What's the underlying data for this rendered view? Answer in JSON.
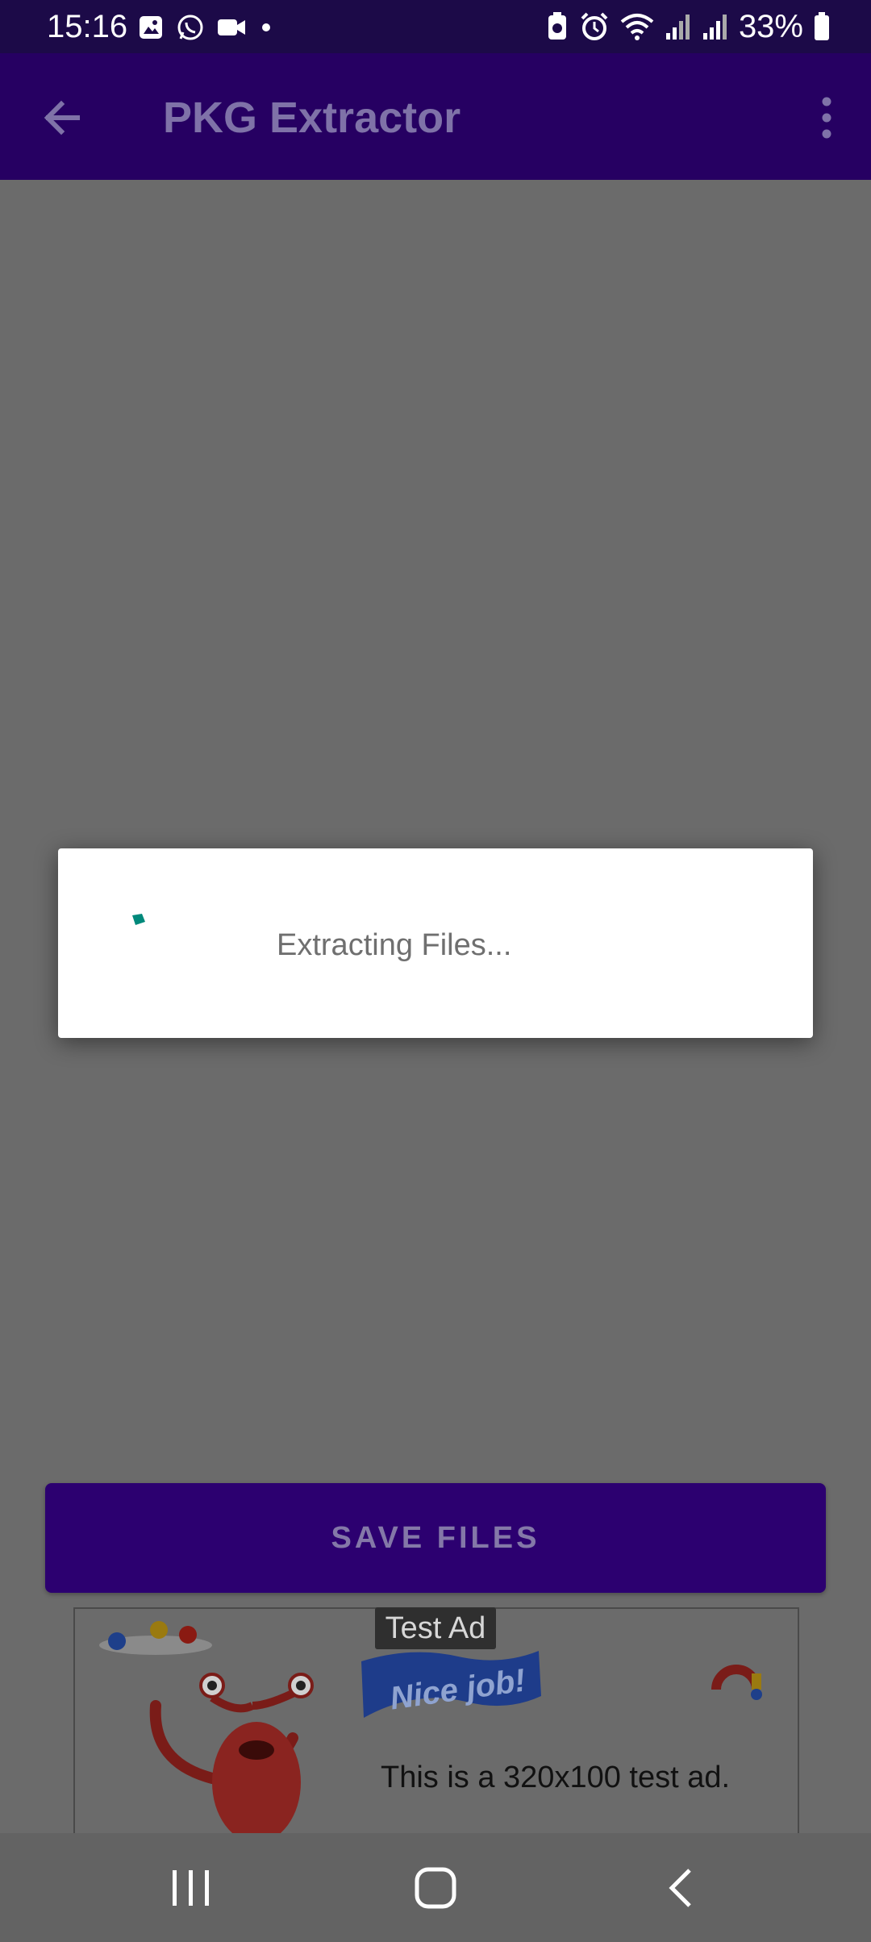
{
  "status_bar": {
    "time": "15:16",
    "battery_percent": "33%",
    "icons": [
      "gallery-icon",
      "whatsapp-icon",
      "video-icon",
      "dot-icon",
      "battery-saver-icon",
      "alarm-icon",
      "wifi-icon",
      "signal-icon",
      "signal-icon",
      "battery-icon"
    ]
  },
  "app_bar": {
    "title": "PKG Extractor",
    "back_icon": "arrow-left-icon",
    "menu_icon": "more-vert-icon"
  },
  "dialog": {
    "message": "Extracting Files...",
    "spinner_color": "#00897b"
  },
  "save_button": {
    "label": "SAVE FILES"
  },
  "ad": {
    "badge": "Test Ad",
    "banner_text": "Nice job!",
    "description": "This is a 320x100 test ad."
  },
  "colors": {
    "app_bar": "#260062",
    "status_bar": "#1c0a48",
    "button": "#2c0070",
    "scrim": "#6b6b6b"
  }
}
